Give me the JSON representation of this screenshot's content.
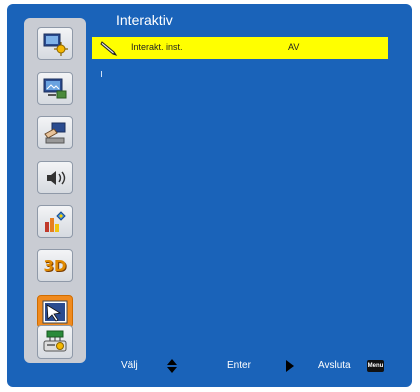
{
  "title": "Interaktiv",
  "menu_row": {
    "label": "Interakt. inst.",
    "value": "AV"
  },
  "sidebar": {
    "items": [
      {
        "icon": "display-image-icon"
      },
      {
        "icon": "screen-icon"
      },
      {
        "icon": "setup-icon"
      },
      {
        "icon": "volume-icon"
      },
      {
        "icon": "options-icon"
      },
      {
        "icon": "3d-icon",
        "label": "3D"
      },
      {
        "icon": "interactive-icon",
        "selected": true
      },
      {
        "icon": "network-icon"
      }
    ]
  },
  "footer": {
    "select_label": "Välj",
    "enter_label": "Enter",
    "exit_label": "Avsluta",
    "menu_key_label": "Menu"
  },
  "colors": {
    "background": "#1a63b9",
    "highlight": "#ffff00",
    "selected_tab": "#f08a1e",
    "sidebar": "#c9ccd3"
  }
}
